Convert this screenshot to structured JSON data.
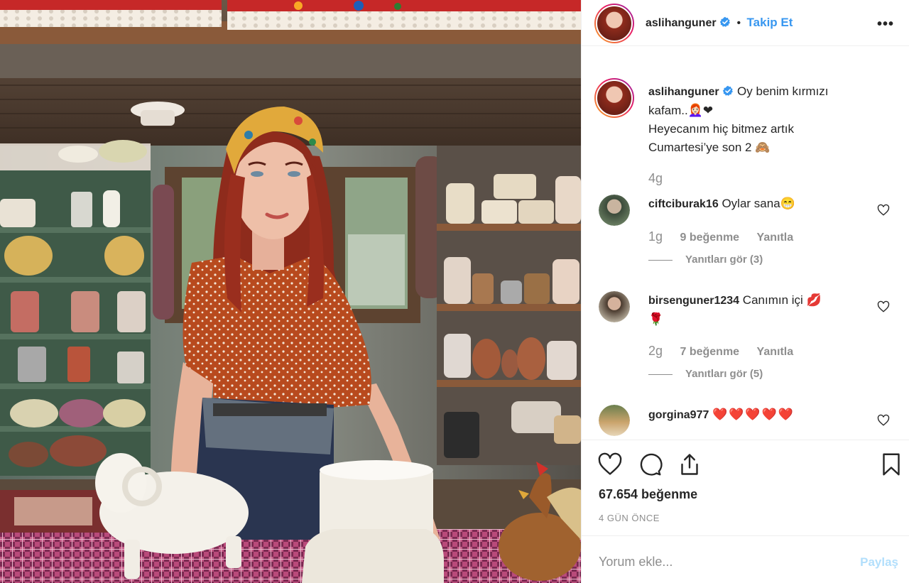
{
  "post": {
    "username": "aslihanguner",
    "follow_label": "Takip Et",
    "separator": "•",
    "more_icon": "more-horizontal-icon"
  },
  "caption": {
    "username": "aslihanguner",
    "line1": "Oy benim kırmızı",
    "line2": "kafam..👩🏻‍🦰❤",
    "line3": "Heyecanım hiç bitmez artık",
    "line4": "Cumartesi’ye son 2 🙈",
    "time": "4g"
  },
  "comments": [
    {
      "username": "ciftciburak16",
      "text": "Oylar sana😁",
      "time": "1g",
      "likes": "9 beğenme",
      "reply": "Yanıtla",
      "view_replies": "Yanıtları gör (3)"
    },
    {
      "username": "birsenguner1234",
      "text": "Canımın içi 💋",
      "text2": "🌹",
      "time": "2g",
      "likes": "7 beğenme",
      "reply": "Yanıtla",
      "view_replies": "Yanıtları gör (5)"
    },
    {
      "username": "gorgina977",
      "text": "❤️❤️❤️❤️❤️"
    }
  ],
  "actions": {
    "like_count": "67.654 beğenme",
    "time_ago": "4 GÜN ÖNCE"
  },
  "add_comment": {
    "placeholder": "Yorum ekle...",
    "post_label": "Paylaş"
  },
  "colors": {
    "link_blue": "#3897f0",
    "muted": "#8e8e8e",
    "text": "#262626",
    "post_disabled": "#b2dffc"
  }
}
